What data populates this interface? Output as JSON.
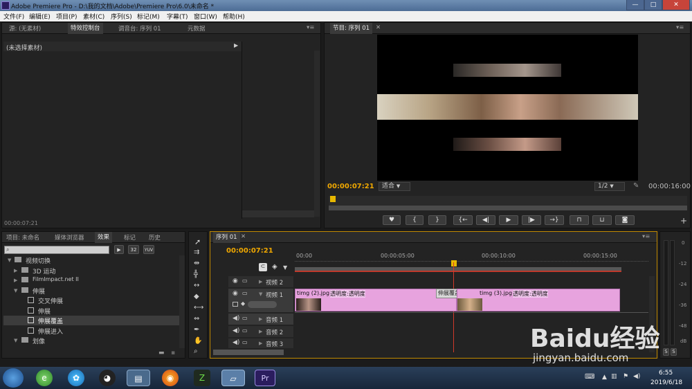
{
  "window": {
    "title": "Adobe Premiere Pro - D:\\我的文档\\Adobe\\Premiere Pro\\6.0\\未命名 *",
    "min": "—",
    "max": "□",
    "close": "✕"
  },
  "menu": [
    "文件(F)",
    "编辑(E)",
    "项目(P)",
    "素材(C)",
    "序列(S)",
    "标记(M)",
    "字幕(T)",
    "窗口(W)",
    "帮助(H)"
  ],
  "source_panel": {
    "tabs": [
      "源: (无素材)",
      "特效控制台",
      "调音台: 序列 01",
      "元数据"
    ],
    "no_clip": "(未选择素材)",
    "timecode": "00:00:07:21"
  },
  "program_panel": {
    "tab": "节目: 序列 01",
    "timecode": "00:00:07:21",
    "fit": "适合",
    "resolution": "1/2",
    "duration": "00:00:16:00"
  },
  "project_panel": {
    "tabs": [
      "项目: 未命名",
      "媒体浏览器",
      "效果",
      "标记",
      "历史"
    ],
    "tree": [
      {
        "label": "视频切换",
        "level": 0,
        "type": "folder",
        "open": true
      },
      {
        "label": "3D 运动",
        "level": 1,
        "type": "folder",
        "open": false
      },
      {
        "label": "FilmImpact.net II",
        "level": 1,
        "type": "folder",
        "open": false
      },
      {
        "label": "伸展",
        "level": 1,
        "type": "folder",
        "open": true
      },
      {
        "label": "交叉伸展",
        "level": 2,
        "type": "effect"
      },
      {
        "label": "伸展",
        "level": 2,
        "type": "effect"
      },
      {
        "label": "伸展覆盖",
        "level": 2,
        "type": "effect",
        "selected": true
      },
      {
        "label": "伸展进入",
        "level": 2,
        "type": "effect"
      },
      {
        "label": "划像",
        "level": 1,
        "type": "folder",
        "open": true
      }
    ],
    "badges": [
      "32",
      "YUV"
    ]
  },
  "timeline": {
    "tab": "序列 01",
    "timecode": "00:00:07:21",
    "ruler": [
      "00:00",
      "00:00:05:00",
      "00:00:10:00",
      "00:00:15:00"
    ],
    "tracks": {
      "v2": "视频 2",
      "v1": "视频 1",
      "a1": "音频 1",
      "a2": "音频 2",
      "a3": "音频 3"
    },
    "clip1": {
      "name": "timg (2).jpg",
      "fx": "透明度:透明度"
    },
    "transition": "伸展覆盖",
    "clip2": {
      "name": "timg (3).jpg",
      "fx": "透明度:透明度"
    }
  },
  "meter": {
    "labels": [
      "0",
      "-12",
      "-24",
      "-36",
      "-48",
      "dB"
    ],
    "solo": [
      "S",
      "S"
    ]
  },
  "taskbar": {
    "time": "6:55",
    "date": "2019/6/18",
    "active_app": "Pr"
  },
  "watermark": {
    "brand": "Baidu经验",
    "url": "jingyan.baidu.com"
  }
}
